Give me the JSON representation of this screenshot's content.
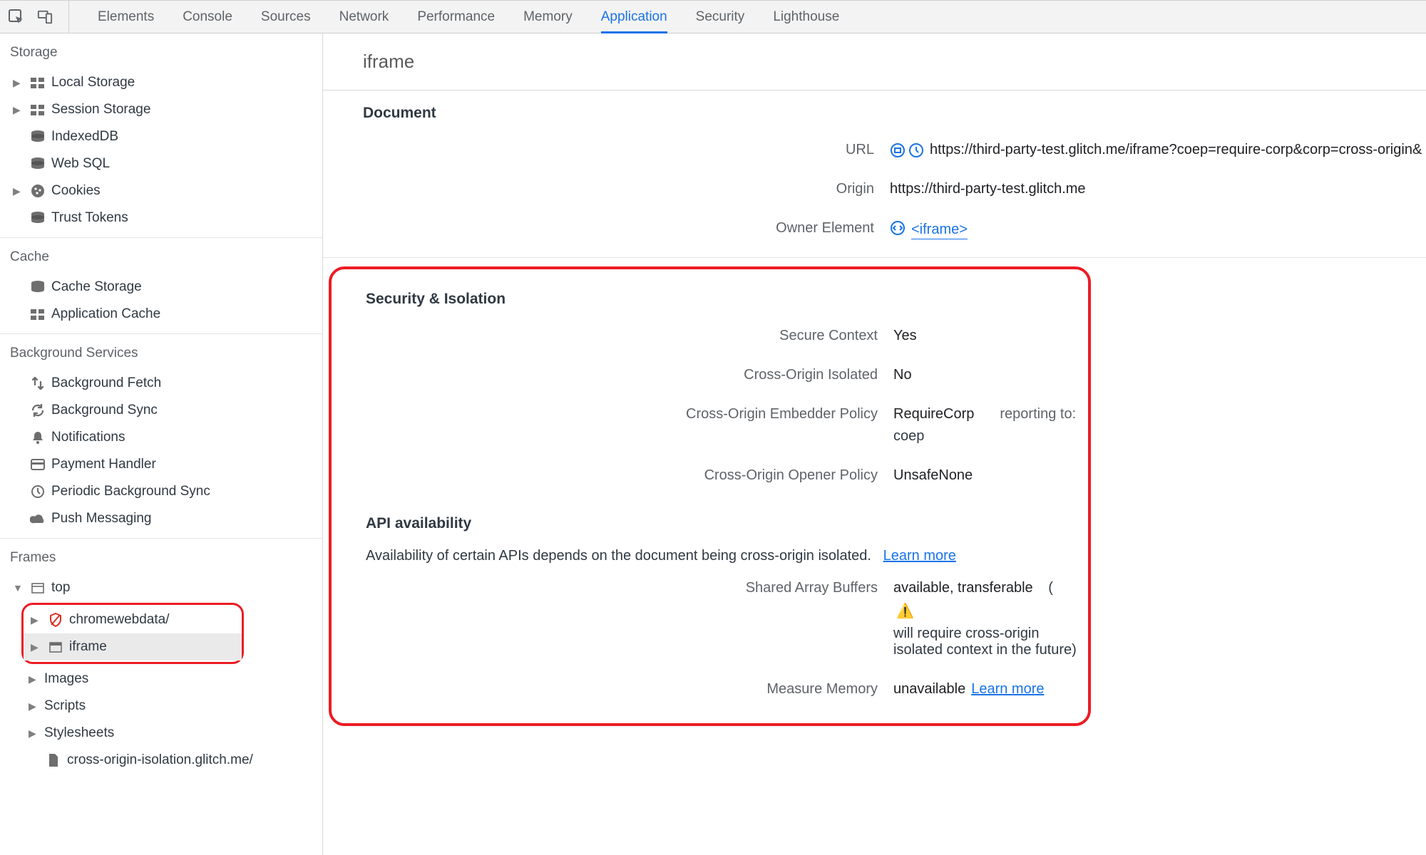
{
  "topbar": {
    "tabs": [
      "Elements",
      "Console",
      "Sources",
      "Network",
      "Performance",
      "Memory",
      "Application",
      "Security",
      "Lighthouse"
    ],
    "active_tab": "Application"
  },
  "sidebar": {
    "storage": {
      "title": "Storage",
      "items": [
        {
          "label": "Local Storage",
          "icon": "grid",
          "expandable": true
        },
        {
          "label": "Session Storage",
          "icon": "grid",
          "expandable": true
        },
        {
          "label": "IndexedDB",
          "icon": "db",
          "expandable": false
        },
        {
          "label": "Web SQL",
          "icon": "db",
          "expandable": false
        },
        {
          "label": "Cookies",
          "icon": "cookie",
          "expandable": true
        },
        {
          "label": "Trust Tokens",
          "icon": "db",
          "expandable": false
        }
      ]
    },
    "cache": {
      "title": "Cache",
      "items": [
        {
          "label": "Cache Storage",
          "icon": "db",
          "expandable": false
        },
        {
          "label": "Application Cache",
          "icon": "grid",
          "expandable": false
        }
      ]
    },
    "background": {
      "title": "Background Services",
      "items": [
        {
          "label": "Background Fetch",
          "icon": "arrows"
        },
        {
          "label": "Background Sync",
          "icon": "sync"
        },
        {
          "label": "Notifications",
          "icon": "bell"
        },
        {
          "label": "Payment Handler",
          "icon": "card"
        },
        {
          "label": "Periodic Background Sync",
          "icon": "clock"
        },
        {
          "label": "Push Messaging",
          "icon": "cloud"
        }
      ]
    },
    "frames": {
      "title": "Frames",
      "top_label": "top",
      "highlighted": [
        {
          "label": "chromewebdata/",
          "icon": "shield-red"
        },
        {
          "label": "iframe",
          "icon": "frame"
        }
      ],
      "rest": [
        {
          "label": "Images"
        },
        {
          "label": "Scripts"
        },
        {
          "label": "Stylesheets"
        },
        {
          "label": "cross-origin-isolation.glitch.me/",
          "icon": "doc"
        }
      ]
    }
  },
  "main": {
    "title": "iframe",
    "document": {
      "heading": "Document",
      "url_label": "URL",
      "url_value": "https://third-party-test.glitch.me/iframe?coep=require-corp&corp=cross-origin&",
      "origin_label": "Origin",
      "origin_value": "https://third-party-test.glitch.me",
      "owner_label": "Owner Element",
      "owner_value": "<iframe>"
    },
    "security": {
      "heading": "Security & Isolation",
      "rows": [
        {
          "k": "Secure Context",
          "v": "Yes"
        },
        {
          "k": "Cross-Origin Isolated",
          "v": "No"
        },
        {
          "k": "Cross-Origin Embedder Policy",
          "v": "RequireCorp",
          "reporting_label": "reporting to:",
          "reporting_value": "coep"
        },
        {
          "k": "Cross-Origin Opener Policy",
          "v": "UnsafeNone"
        }
      ]
    },
    "api": {
      "heading": "API availability",
      "description_prefix": "Availability of certain APIs depends on the document being cross-origin isolated.",
      "learn_more": "Learn more",
      "rows": [
        {
          "k": "Shared Array Buffers",
          "v": "available, transferable",
          "note_prefix": "(",
          "note_text": "will require cross-origin isolated context in the future)",
          "warn": true
        },
        {
          "k": "Measure Memory",
          "v": "unavailable",
          "link": "Learn more"
        }
      ]
    }
  }
}
